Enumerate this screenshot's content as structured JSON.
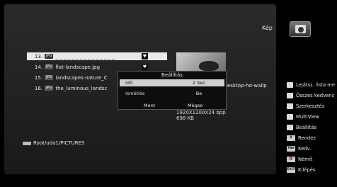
{
  "header": {
    "title": "Kép",
    "icon": "camera-icon"
  },
  "file_list": [
    {
      "num": "13.",
      "type": "JPG",
      "name": "_ _ _ _ _ _ _ _ _ _ _ _ _ _ _",
      "selected": true
    },
    {
      "num": "14.",
      "type": "JPG",
      "name": "flat-landscape.jpg",
      "selected": false
    },
    {
      "num": "15.",
      "type": "JPG",
      "name": "landscapes-nature_C",
      "selected": false
    },
    {
      "num": "16.",
      "type": "JPG",
      "name": "the_luminous_landsc",
      "selected": false
    }
  ],
  "preview": {
    "caption": "lesktop-hd-wallp",
    "resolution": "1920X1200X24 bpp",
    "size": "698 KB"
  },
  "dialog": {
    "title": "Beállítás",
    "rows": [
      {
        "label": "Idő",
        "value": "2 Sec"
      },
      {
        "label": "Ismétlés",
        "value": "Be"
      }
    ],
    "save": "Ment",
    "cancel": "Mégse"
  },
  "path": "Root/uda1/PICTURES",
  "menu": [
    {
      "icon": "square-icon",
      "key": "",
      "label": "Lejátsz. lista me"
    },
    {
      "icon": "square-icon",
      "key": "",
      "label": "Összes kedvenc"
    },
    {
      "icon": "square-icon",
      "key": "",
      "label": "Szerkesztés"
    },
    {
      "icon": "square-icon",
      "key": "",
      "label": "MultiView"
    },
    {
      "icon": "square-icon",
      "key": "",
      "label": "Beállítás"
    },
    {
      "icon": "key-icon",
      "key": "0",
      "label": "Rendez"
    },
    {
      "icon": "key-icon",
      "key": "FAV",
      "label": "Kedv."
    },
    {
      "icon": "key-icon",
      "key": "🔇",
      "label": "Némít"
    },
    {
      "icon": "key-icon",
      "key": "EXIT",
      "label": "Kilépés"
    }
  ]
}
